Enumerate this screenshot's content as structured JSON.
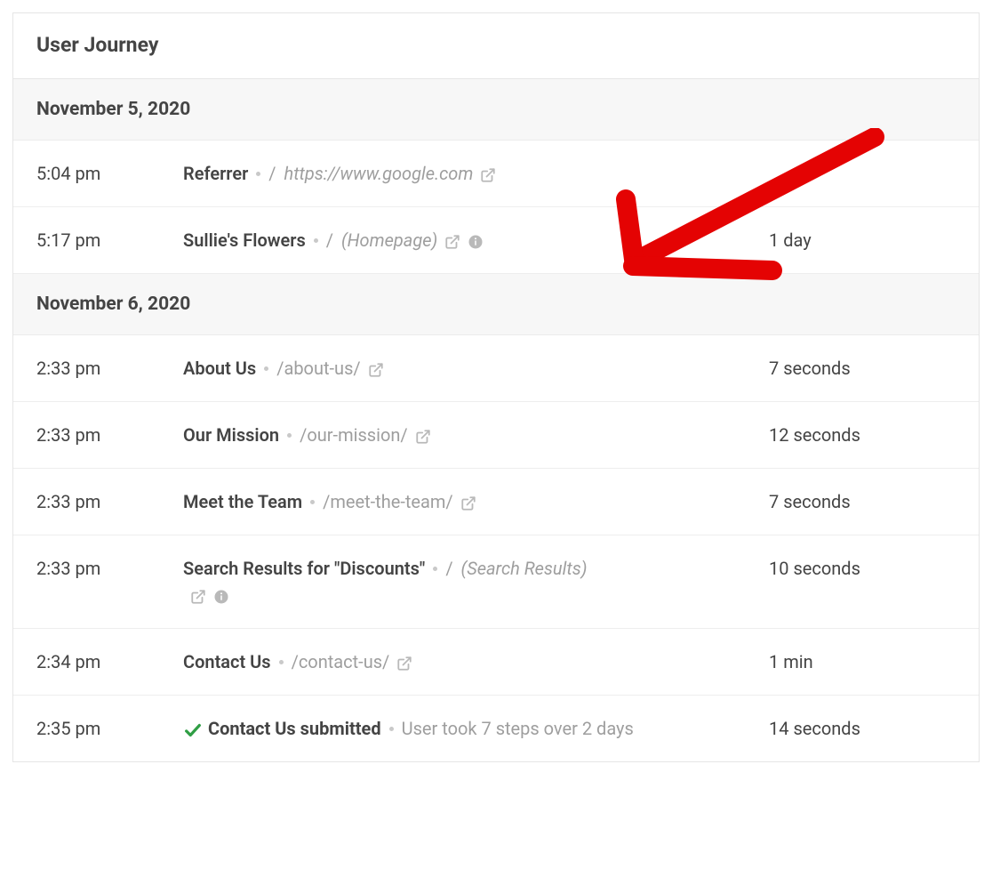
{
  "card": {
    "title": "User Journey"
  },
  "groups": [
    {
      "date": "November 5, 2020",
      "rows": [
        {
          "time": "5:04 pm",
          "title": "Referrer",
          "showSlash": true,
          "path": "https://www.google.com",
          "pathItalic": true,
          "hasExternal": true,
          "hasInfo": false,
          "duration": ""
        },
        {
          "time": "5:17 pm",
          "title": "Sullie's Flowers",
          "showSlash": true,
          "path": "(Homepage)",
          "pathItalic": true,
          "hasExternal": true,
          "hasInfo": true,
          "duration": "1 day",
          "arrow": true
        }
      ]
    },
    {
      "date": "November 6, 2020",
      "rows": [
        {
          "time": "2:33 pm",
          "title": "About Us",
          "showSlash": false,
          "path": "/about-us/",
          "pathItalic": false,
          "hasExternal": true,
          "hasInfo": false,
          "duration": "7 seconds"
        },
        {
          "time": "2:33 pm",
          "title": "Our Mission",
          "showSlash": false,
          "path": "/our-mission/",
          "pathItalic": false,
          "hasExternal": true,
          "hasInfo": false,
          "duration": "12 seconds"
        },
        {
          "time": "2:33 pm",
          "title": "Meet the Team",
          "showSlash": false,
          "path": "/meet-the-team/",
          "pathItalic": false,
          "hasExternal": true,
          "hasInfo": false,
          "duration": "7 seconds"
        },
        {
          "time": "2:33 pm",
          "title": "Search Results for \"Discounts\"",
          "showSlash": true,
          "path": "(Search Results)",
          "pathItalic": true,
          "hasExternal": true,
          "extBelow": true,
          "hasInfo": true,
          "duration": "10 seconds"
        },
        {
          "time": "2:34 pm",
          "title": "Contact Us",
          "showSlash": false,
          "path": "/contact-us/",
          "pathItalic": false,
          "hasExternal": true,
          "hasInfo": false,
          "duration": "1 min"
        },
        {
          "time": "2:35 pm",
          "submitted": true,
          "title": "Contact Us submitted",
          "note": "User took 7 steps over 2 days",
          "duration": "14 seconds"
        }
      ]
    }
  ]
}
